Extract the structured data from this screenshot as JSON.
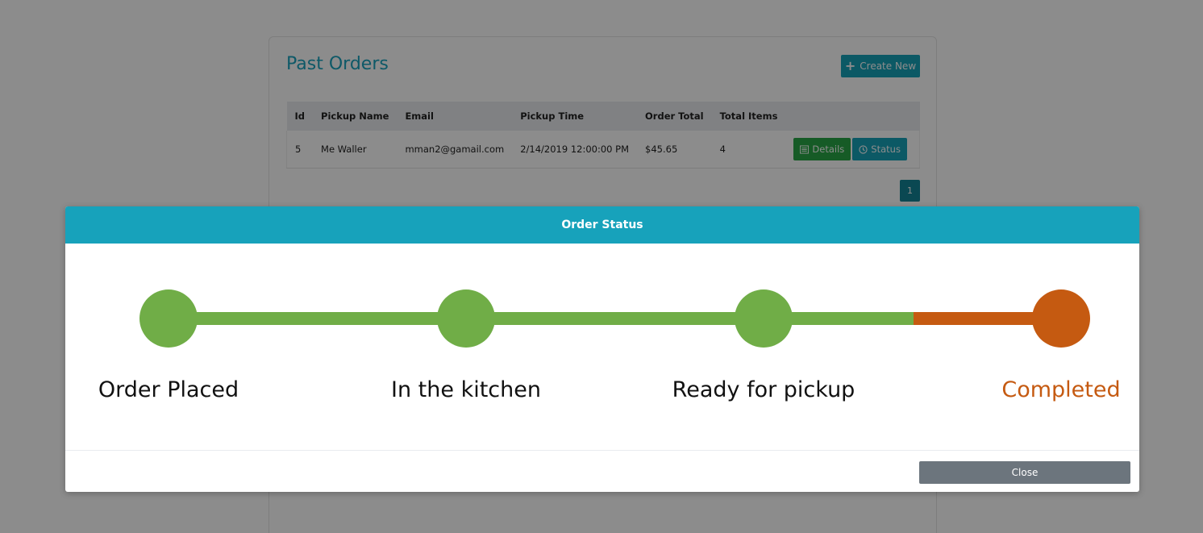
{
  "page": {
    "title": "Past Orders",
    "create_label": "Create New",
    "table": {
      "headers": [
        "Id",
        "Pickup Name",
        "Email",
        "Pickup Time",
        "Order Total",
        "Total Items",
        ""
      ],
      "rows": [
        {
          "id": "5",
          "pickup_name": "Me Waller",
          "email": "mman2@gamail.com",
          "pickup_time": "2/14/2019 12:00:00 PM",
          "order_total": "$45.65",
          "total_items": "4",
          "details_label": "Details",
          "status_label": "Status"
        }
      ]
    },
    "pager": {
      "current_page": "1"
    }
  },
  "modal": {
    "title": "Order Status",
    "steps": [
      {
        "label": "Order Placed",
        "state": "done"
      },
      {
        "label": "In the kitchen",
        "state": "done"
      },
      {
        "label": "Ready for pickup",
        "state": "done"
      },
      {
        "label": "Completed",
        "state": "current"
      }
    ],
    "close_label": "Close"
  },
  "colors": {
    "accent": "#17a2b8",
    "step_done": "#70ad47",
    "step_current": "#c55a11",
    "details_button": "#28a745",
    "close_button": "#6c757d"
  },
  "icons": {
    "create": "plus-icon",
    "details": "list-alt-icon",
    "status": "clock-icon"
  }
}
